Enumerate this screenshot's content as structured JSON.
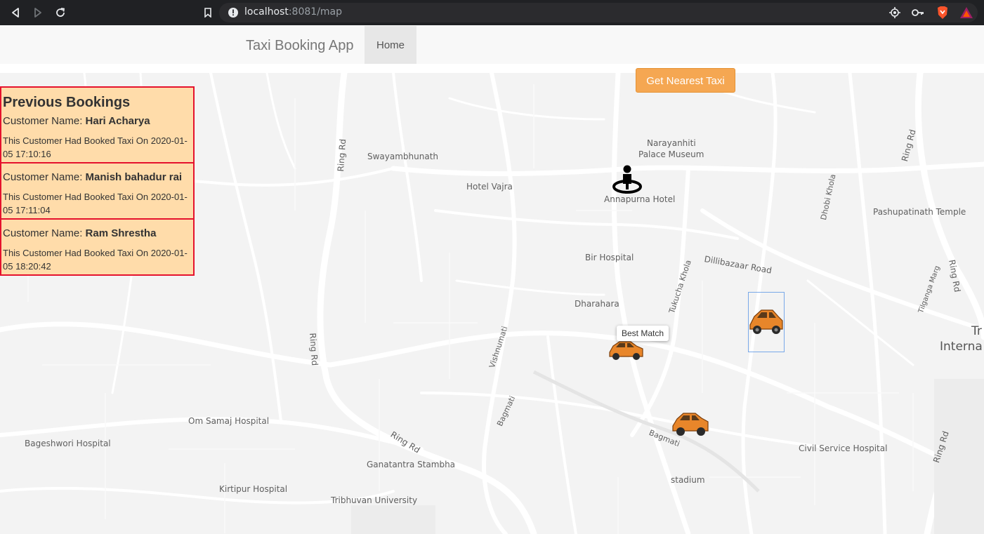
{
  "browser": {
    "url_host": "localhost",
    "url_path": ":8081/map"
  },
  "navbar": {
    "brand": "Taxi Booking App",
    "home": "Home"
  },
  "map": {
    "button_label": "Get Nearest Taxi",
    "tooltip": "Best Match",
    "labels": {
      "swayambhunath": "Swayambhunath",
      "narayanhiti1": "Narayanhiti",
      "narayanhiti2": "Palace Museum",
      "hotel_vajra": "Hotel Vajra",
      "annapurna": "Annapurna Hotel",
      "pashupatinath": "Pashupatinath Temple",
      "dillibazaar": "Dillibazaar Road",
      "bir_hospital": "Bir Hospital",
      "dharahara": "Dharahara",
      "tukucha": "Tukucha Khola",
      "dhobi": "Dhobi Khola",
      "tilganga": "Tilganga Marg",
      "ring_rd_1": "Ring Rd",
      "ring_rd_2": "Ring Rd",
      "ring_rd_3": "Ring Rd",
      "ring_rd_4": "Ring Rd",
      "ring_rd_5": "Ring Rd",
      "ring_rd_6": "Ring Rd",
      "vishnumati": "Vishnumati",
      "bagmati_1": "Bagmati",
      "bagmati_2": "Bagmati",
      "om_samaj": "Om Samaj Hospital",
      "bageshwori": "Bageshwori Hospital",
      "ganatantra": "Ganatantra Stambha",
      "kirtipur": "Kirtipur Hospital",
      "tribhuvan": "Tribhuvan University",
      "stadium": "stadium",
      "civil": "Civil Service Hospital",
      "tri_1": "Tr",
      "tri_2": "Interna"
    }
  },
  "bookings": {
    "title": "Previous Bookings",
    "customer_label": "Customer Name:",
    "items": [
      {
        "name": "Hari Acharya",
        "text": "This Customer Had Booked Taxi On 2020-01-05 17:10:16"
      },
      {
        "name": "Manish bahadur rai",
        "text": "This Customer Had Booked Taxi On 2020-01-05 17:11:04"
      },
      {
        "name": "Ram Shrestha",
        "text": "This Customer Had Booked Taxi On 2020-01-05 18:20:42"
      }
    ]
  },
  "colors": {
    "accent_button": "#f5a752",
    "booking_bg": "#ffdcaa",
    "booking_border": "#e5122d",
    "taxi": "#e8862a"
  }
}
